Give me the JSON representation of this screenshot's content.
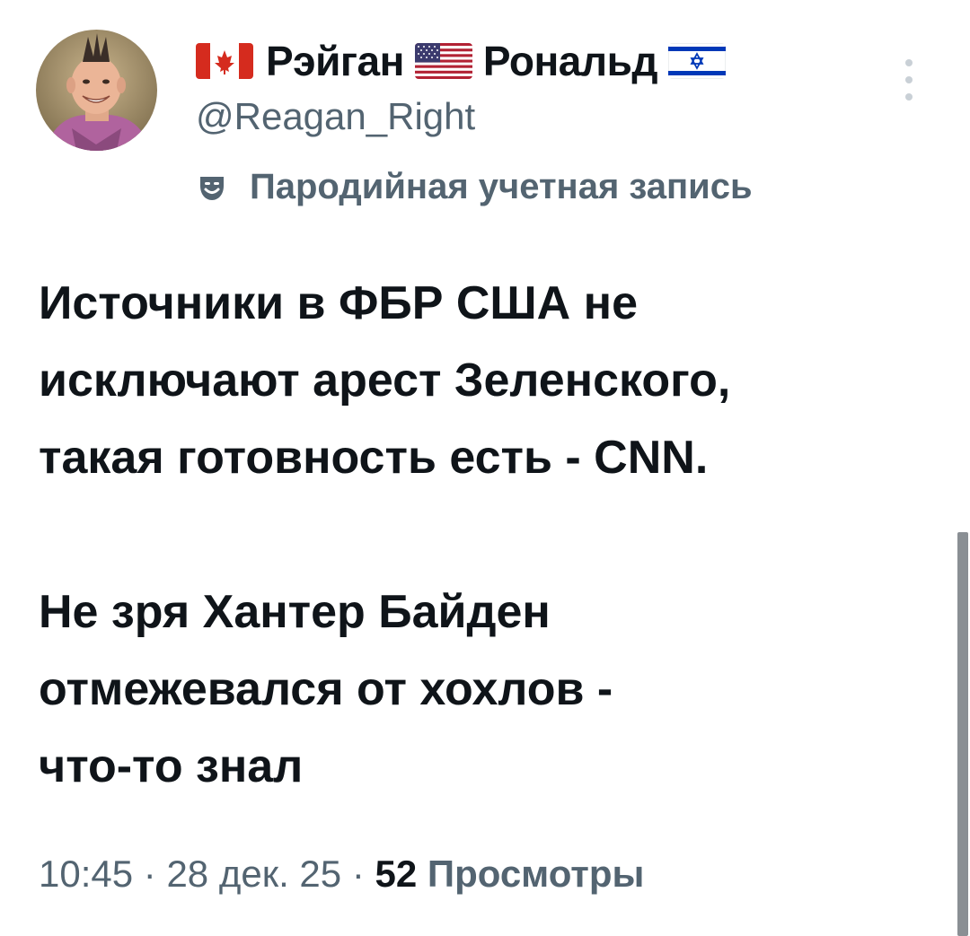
{
  "tweet": {
    "author": {
      "name_parts": [
        "Рэйган",
        "Рональд"
      ],
      "flags": [
        "canada-flag",
        "usa-flag",
        "israel-flag"
      ],
      "handle": "@Reagan_Right",
      "account_label": "Пародийная учетная запись",
      "account_label_icon": "theater-mask-icon"
    },
    "body": {
      "paragraph_1": [
        "Источники в ФБР США не",
        "исключают арест Зеленского,",
        "такая готовность есть - CNN."
      ],
      "paragraph_2": [
        "Не зря Хантер Байден",
        "отмежевался от хохлов -",
        "что-то знал"
      ]
    },
    "meta": {
      "time": "10:45",
      "separator": "·",
      "date": "28 дек. 25",
      "views_count": "52",
      "views_label": "Просмотры"
    },
    "more_icon": "more-vertical-icon"
  },
  "colors": {
    "text_primary": "#0f1419",
    "text_secondary": "#536471",
    "background": "#ffffff"
  }
}
